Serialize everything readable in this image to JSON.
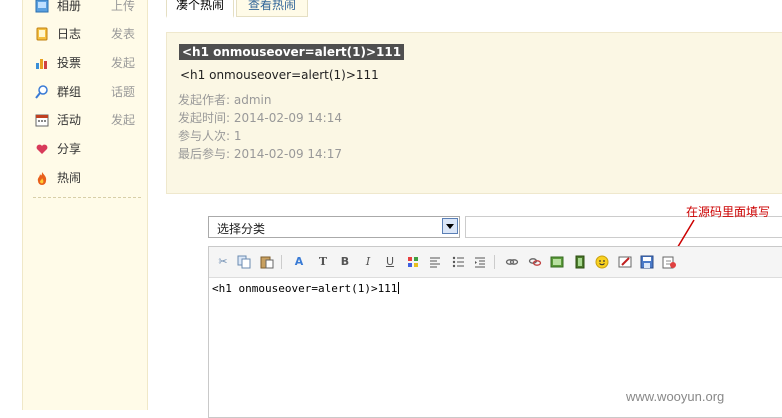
{
  "sidebar": {
    "items": [
      {
        "label": "相册",
        "action": "上传",
        "icon": "photo-album-icon",
        "color": "#3a8fd8"
      },
      {
        "label": "日志",
        "action": "发表",
        "icon": "notebook-icon",
        "color": "#e8a020"
      },
      {
        "label": "投票",
        "action": "发起",
        "icon": "bar-chart-icon",
        "color": "#d04040"
      },
      {
        "label": "群组",
        "action": "话题",
        "icon": "group-icon",
        "color": "#3a7bd5"
      },
      {
        "label": "活动",
        "action": "发起",
        "icon": "calendar-icon",
        "color": "#c04020"
      },
      {
        "label": "分享",
        "action": "",
        "icon": "heart-icon",
        "color": "#d83a5a"
      },
      {
        "label": "热闹",
        "action": "",
        "icon": "fire-icon",
        "color": "#e8601c"
      }
    ]
  },
  "tabs": {
    "active": "凑个热闹",
    "inactive": "查看热闹"
  },
  "panel": {
    "title": "<h1 onmouseover=alert(1)>111",
    "subtitle": "<h1 onmouseover=alert(1)>111",
    "author": "发起作者: admin",
    "start_time": "发起时间: 2014-02-09 14:14",
    "participants": "参与人次: 1",
    "last_participation": "最后参与: 2014-02-09 14:17"
  },
  "form": {
    "category_select_value": "选择分类",
    "title_input_value": ""
  },
  "annotation": "在源码里面填写",
  "editor": {
    "content": "<h1 onmouseover=alert(1)>111",
    "toolbar_icons": [
      "cut-icon",
      "copy-icon",
      "paste-icon",
      "font-icon",
      "font-size-icon",
      "bold-icon",
      "italic-icon",
      "underline-icon",
      "color-icon",
      "align-icon",
      "list-icon",
      "indent-icon",
      "link-icon",
      "unlink-icon",
      "image-icon",
      "video-icon",
      "smiley-icon",
      "edit-icon",
      "save-icon",
      "source-icon"
    ]
  },
  "watermark": "www.wooyun.org"
}
